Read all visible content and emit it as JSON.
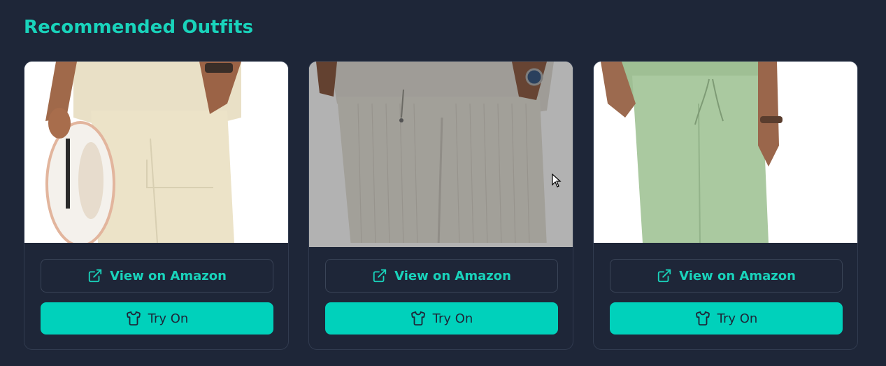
{
  "section": {
    "title": "Recommended Outfits"
  },
  "cards": [
    {
      "amazon_label": "View on Amazon",
      "tryon_label": "Try On",
      "image_desc": "cream linen pants"
    },
    {
      "amazon_label": "View on Amazon",
      "tryon_label": "Try On",
      "image_desc": "beige ribbed pants"
    },
    {
      "amazon_label": "View on Amazon",
      "tryon_label": "Try On",
      "image_desc": "sage green pants"
    }
  ],
  "icons": {
    "external_link": "external-link-icon",
    "shirt": "shirt-icon"
  },
  "colors": {
    "background": "#1e2638",
    "accent": "#19d3bb",
    "button_fill": "#00d1bb",
    "border": "#313b4f"
  }
}
